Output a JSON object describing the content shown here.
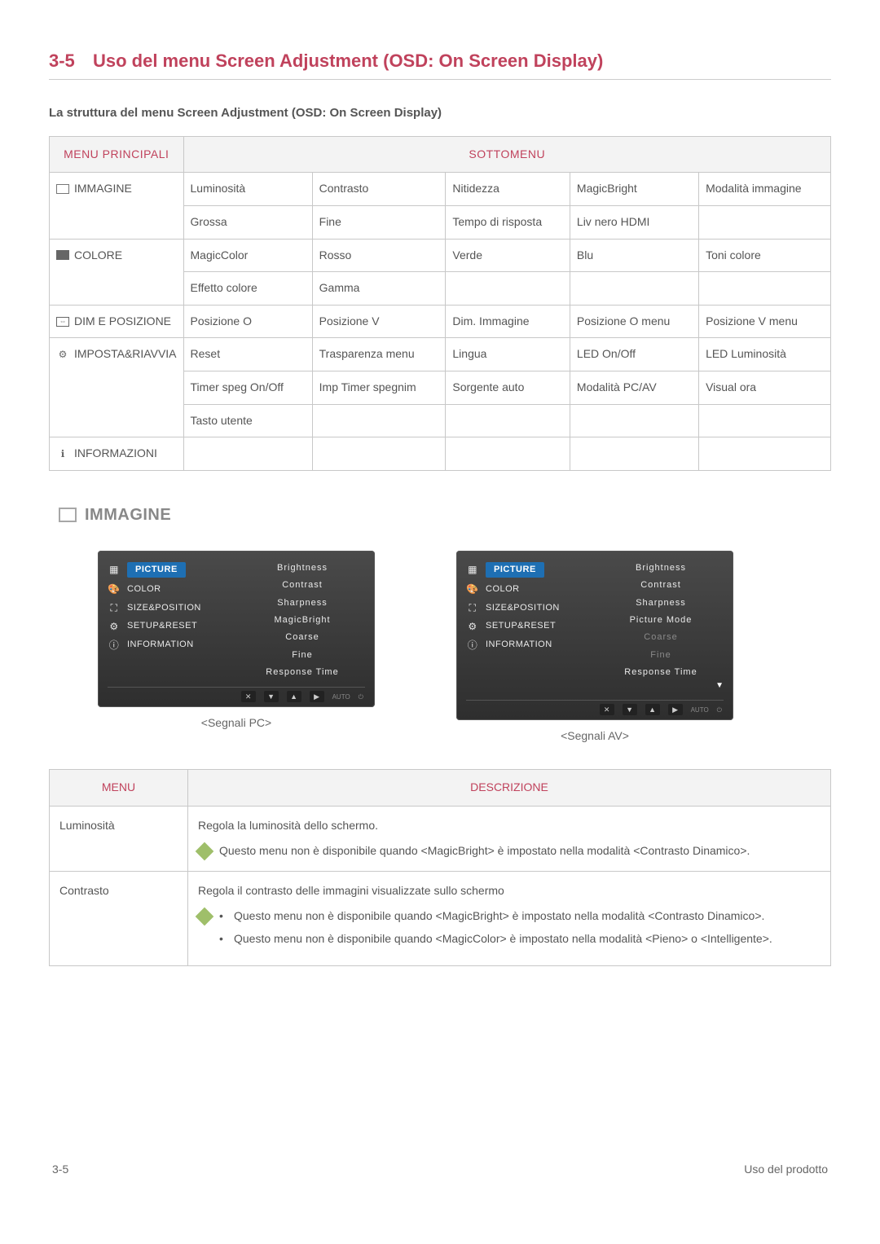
{
  "header": {
    "section_number": "3-5",
    "title": "Uso del menu Screen Adjustment (OSD: On Screen Display)"
  },
  "subtitle": "La struttura del menu Screen Adjustment (OSD: On Screen Display)",
  "structure_table": {
    "header_main": "MENU PRINCIPALI",
    "header_sub": "SOTTOMENU",
    "rows": [
      {
        "main": "IMMAGINE",
        "cells": [
          "Luminosità",
          "Contrasto",
          "Nitidezza",
          "MagicBright",
          "Modalità immagine"
        ]
      },
      {
        "main": "",
        "cells": [
          "Grossa",
          "Fine",
          "Tempo di risposta",
          "Liv nero HDMI",
          ""
        ]
      },
      {
        "main": "COLORE",
        "cells": [
          "MagicColor",
          "Rosso",
          "Verde",
          "Blu",
          "Toni colore"
        ]
      },
      {
        "main": "",
        "cells": [
          "Effetto colore",
          "Gamma",
          "",
          "",
          ""
        ]
      },
      {
        "main": "DIM E POSIZIONE",
        "cells": [
          "Posizione O",
          "Posizione V",
          "Dim. Immagine",
          "Posizione O menu",
          "Posizione V menu"
        ]
      },
      {
        "main": "IMPOSTA&RIAVVIA",
        "cells": [
          "Reset",
          "Trasparenza menu",
          "Lingua",
          "LED On/Off",
          "LED Luminosità"
        ]
      },
      {
        "main": "",
        "cells": [
          "Timer speg On/Off",
          "Imp Timer spegnim",
          "Sorgente auto",
          "Modalità PC/AV",
          "Visual ora"
        ]
      },
      {
        "main": "",
        "cells": [
          "Tasto utente",
          "",
          "",
          "",
          ""
        ]
      },
      {
        "main": "INFORMAZIONI",
        "cells": [
          "",
          "",
          "",
          "",
          ""
        ]
      }
    ]
  },
  "immagine_heading": "IMMAGINE",
  "osd": {
    "left_items": [
      {
        "glyph": "",
        "label": "PICTURE",
        "active": true
      },
      {
        "glyph": "🎨",
        "label": "COLOR"
      },
      {
        "glyph": "⛶",
        "label": "SIZE&POSITION"
      },
      {
        "glyph": "⚙",
        "label": "SETUP&RESET"
      },
      {
        "glyph": "ⓘ",
        "label": "INFORMATION"
      }
    ],
    "pc": {
      "options": [
        {
          "label": "Brightness",
          "dim": false
        },
        {
          "label": "Contrast",
          "dim": false
        },
        {
          "label": "Sharpness",
          "dim": false
        },
        {
          "label": "MagicBright",
          "dim": false
        },
        {
          "label": "Coarse",
          "dim": false
        },
        {
          "label": "Fine",
          "dim": false
        },
        {
          "label": "Response Time",
          "dim": false
        }
      ],
      "caption": "<Segnali PC>"
    },
    "av": {
      "options": [
        {
          "label": "Brightness",
          "dim": false
        },
        {
          "label": "Contrast",
          "dim": false
        },
        {
          "label": "Sharpness",
          "dim": false
        },
        {
          "label": "Picture Mode",
          "dim": false
        },
        {
          "label": "Coarse",
          "dim": true
        },
        {
          "label": "Fine",
          "dim": true
        },
        {
          "label": "Response Time",
          "dim": false
        }
      ],
      "caption": "<Segnali AV>"
    },
    "footer_buttons": [
      "✕",
      "▼",
      "▲",
      "▶"
    ],
    "footer_labels": [
      "AUTO",
      "⏻"
    ]
  },
  "desc_table": {
    "header_menu": "MENU",
    "header_desc": "DESCRIZIONE",
    "rows": [
      {
        "menu": "Luminosità",
        "text": "Regola la luminosità dello schermo.",
        "notes_plain": "Questo menu non è disponibile quando <MagicBright> è impostato nella modalità <Contrasto Dinamico>."
      },
      {
        "menu": "Contrasto",
        "text": "Regola il contrasto delle immagini visualizzate sullo schermo",
        "notes_list": [
          "Questo menu non è disponibile quando <MagicBright> è impostato nella modalità <Contrasto Dinamico>.",
          "Questo menu non è disponibile quando <MagicColor> è impostato nella modalità <Pieno> o <Intelligente>."
        ]
      }
    ]
  },
  "footer": {
    "left": "3-5",
    "right": "Uso del prodotto"
  }
}
